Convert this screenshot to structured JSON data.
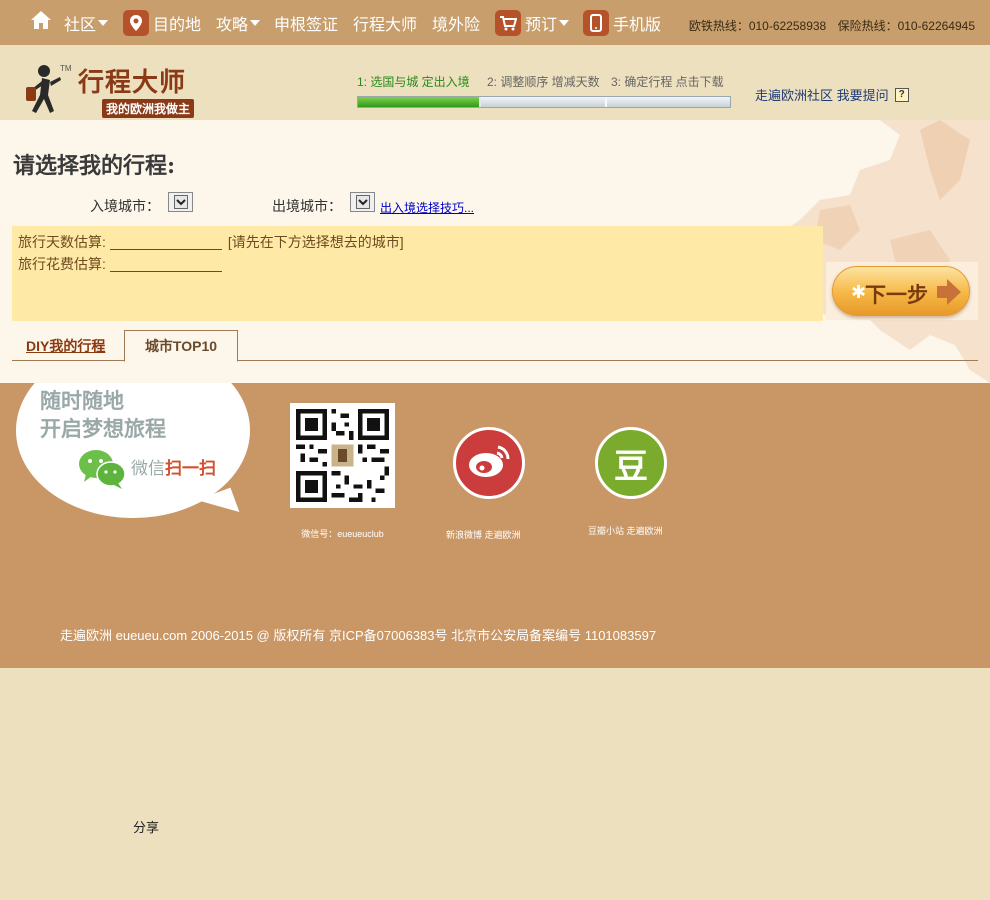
{
  "nav": {
    "items": [
      {
        "label": "社区",
        "caret": true
      },
      {
        "label": "目的地",
        "icon": "map-pin-icon"
      },
      {
        "label": "攻略",
        "caret": true
      },
      {
        "label": "申根签证"
      },
      {
        "label": "行程大师"
      },
      {
        "label": "境外险"
      },
      {
        "label": "预订",
        "icon": "cart-icon",
        "caret": true
      },
      {
        "label": "手机版",
        "icon": "mobile-icon"
      }
    ],
    "hotline_rail": "欧铁热线：010-62258938",
    "hotline_insurance": "保险热线：010-62264945"
  },
  "header": {
    "logo_title": "行程大师",
    "logo_tm": "TM",
    "logo_subtitle": "我的欧洲我做主",
    "steps": [
      "1: 选国与城  定出入境",
      "2: 调整顺序  增减天数",
      "3: 确定行程  点击下载"
    ],
    "progress_active_fraction": 0.33,
    "community_link": "走遍欧洲社区 我要提问",
    "help_label": "?"
  },
  "main": {
    "heading": "请选择我的行程:",
    "entry_city_label": "入境城市：",
    "exit_city_label": "出境城市：",
    "tip_link": "出入境选择技巧...",
    "days_label": "旅行天数估算:",
    "days_hint": "[请先在下方选择想去的城市]",
    "cost_label": "旅行花费估算:",
    "next_button": "下一步",
    "tabs": [
      "DIY我的行程",
      "城市TOP10"
    ]
  },
  "footer": {
    "bubble_line1": "随时随地",
    "bubble_line2": "开启梦想旅程",
    "scan_prefix": "微信",
    "scan_highlight": "扫一扫",
    "wechat_caption": "微信号：eueueuclub",
    "weibo_caption": "新浪微博  走遍欧洲",
    "douban_char": "豆",
    "douban_caption": "豆瓣小站  走遍欧洲",
    "copyright": "走遍欧洲 eueueu.com 2006-2015 @ 版权所有 京ICP备07006383号 北京市公安局备案编号 1101083597"
  },
  "share_label": "分享",
  "colors": {
    "nav_bg": "#c79e6c",
    "page_bg": "#ede0bf",
    "footer_bg": "#c99766",
    "estimate_bg": "#feeaa6",
    "brand_brown": "#8a3a16"
  }
}
